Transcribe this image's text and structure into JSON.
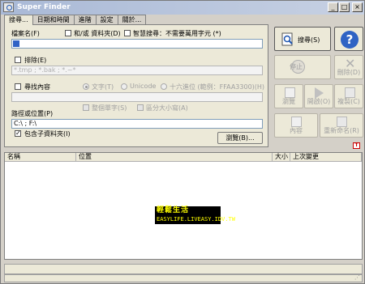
{
  "window": {
    "title": "Super Finder",
    "minimize": "_",
    "maximize": "□",
    "close": "×"
  },
  "tabs": [
    "搜尋...",
    "日期和時間",
    "進階",
    "設定",
    "關於..."
  ],
  "search_form": {
    "filename_label": "檔案名(F)",
    "and_or_label": "和/或 資料夾(D)",
    "smart_search_label": "智慧搜尋：不需要萬用字元 (*)",
    "filename_value": "",
    "exclude_label": "排除(E)",
    "exclude_placeholder": "*.tmp ; *.bak ; *.~*",
    "find_content_label": "尋找內容",
    "text_label": "文字(T)",
    "unicode_label": "Unicode",
    "hex_label": "十六進位 (範例：FFAA3300)(H)",
    "content_value": "",
    "case_label": "整個單字(S)",
    "case_sensitive_label": "區分大小寫(A)",
    "path_label": "路徑或位置(P)",
    "path_value": "C:\\ ; F:\\",
    "subfolders_label": "包含子資料夾(I)",
    "browse_label": "瀏覽(B)..."
  },
  "actions": {
    "search": "搜尋(S)",
    "help": "?",
    "stop": "停止",
    "delete": "刪除(D)",
    "browse": "瀏覽",
    "open": "開啟(O)",
    "copy": "複製(C)",
    "content": "內容",
    "rename": "重新命名(R)"
  },
  "results": {
    "headers": [
      "名稱",
      "位置",
      "大小",
      "上次變更"
    ]
  },
  "watermark": {
    "line1": "輕鬆生活",
    "line2": "EASYLIFE.LIVEASY.IDV.TW"
  },
  "colors": {
    "accent": "#1d55b0",
    "title_gradient_start": "#a9b9d6"
  }
}
